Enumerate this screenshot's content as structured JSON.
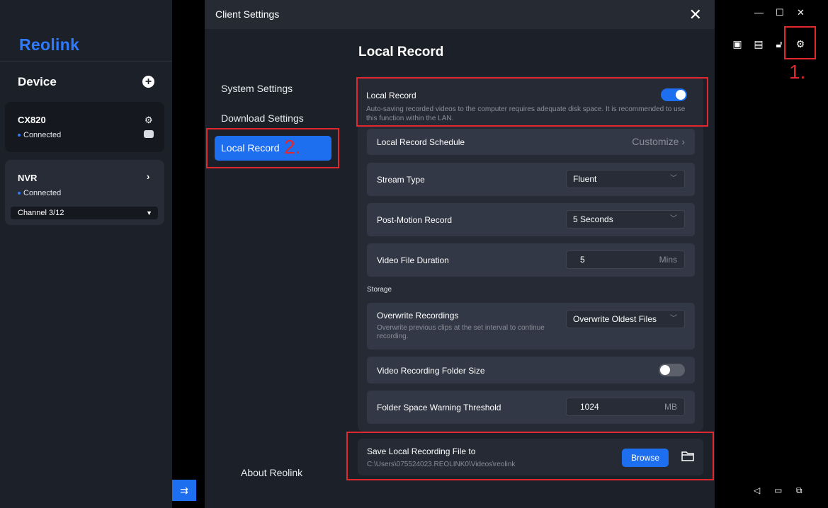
{
  "app": {
    "logo": "Reolink",
    "device_title": "Device",
    "devices": [
      {
        "name": "CX820",
        "status": "Connected"
      },
      {
        "name": "NVR",
        "status": "Connected",
        "channel": "Channel 3/12"
      }
    ]
  },
  "annotations": {
    "step1": "1.",
    "step2": "2.",
    "color": "#e0282e"
  },
  "dialog": {
    "title": "Client Settings",
    "nav": {
      "items": [
        "System Settings",
        "Download Settings",
        "Local Record"
      ],
      "active_index": 2,
      "about": "About Reolink"
    },
    "main": {
      "title": "Local Record",
      "local_record": {
        "label": "Local Record",
        "description": "Auto-saving recorded videos to the computer requires adequate disk space. It is recommended to use this function within the LAN.",
        "enabled": true
      },
      "schedule": {
        "label": "Local Record Schedule",
        "value": "Customize"
      },
      "stream_type": {
        "label": "Stream Type",
        "value": "Fluent"
      },
      "post_motion": {
        "label": "Post-Motion Record",
        "value": "5 Seconds"
      },
      "file_duration": {
        "label": "Video File Duration",
        "value": "5",
        "unit": "Mins"
      },
      "storage_label": "Storage",
      "overwrite": {
        "label": "Overwrite Recordings",
        "description": "Overwrite previous clips at the set interval to continue recording.",
        "value": "Overwrite Oldest Files"
      },
      "folder_size": {
        "label": "Video Recording Folder Size",
        "enabled": false
      },
      "warning_threshold": {
        "label": "Folder Space Warning Threshold",
        "value": "1024",
        "unit": "MB"
      },
      "save_location": {
        "label": "Save Local Recording File to",
        "path": "C:\\Users\\075524023.REOLINK0\\Videos\\reolink",
        "browse_label": "Browse"
      }
    }
  },
  "colors": {
    "accent": "#1e6ef0",
    "brand": "#2f7bff"
  }
}
